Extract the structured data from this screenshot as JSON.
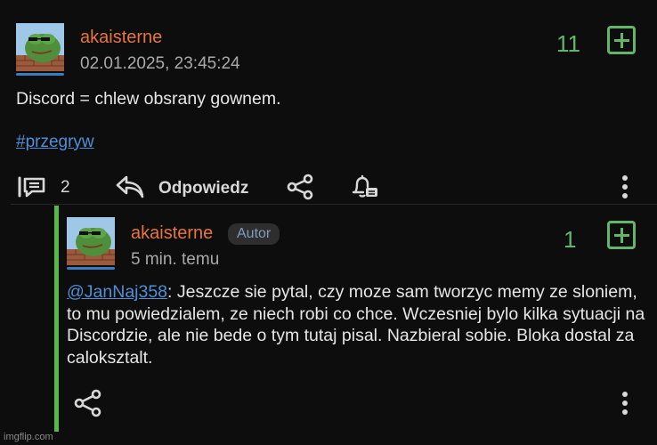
{
  "post": {
    "author": "akaisterne",
    "timestamp": "02.01.2025, 23:45:24",
    "vote_count": "11",
    "content": "Discord = chlew obsrany gownem.",
    "tag": "#przegryw",
    "comment_count": "2",
    "reply_label": "Odpowiedz"
  },
  "reply": {
    "author": "akaisterne",
    "author_badge": "Autor",
    "time_ago": "5 min. temu",
    "vote_count": "1",
    "mention": "@JanNaj358",
    "content": ": Jeszcze sie pytal, czy moze sam tworzyc memy ze sloniem, to mu powiedzialem, ze niech robi co chce. Wczesniej bylo kilka sytuacji na Discordzie, ale nie bede o tym tutaj pisal. Nazbieral sobie. Bloka dostal za caloksztalt."
  },
  "watermark": "imgflip.com",
  "colors": {
    "username": "#e8743b",
    "vote_green": "#63b56a",
    "link_blue": "#4f8fd8",
    "reply_bar": "#57b84a",
    "background": "#0d0d0d"
  },
  "icons": [
    "comments-icon",
    "reply-arrow-icon",
    "share-icon",
    "bell-icon",
    "more-vertical-icon",
    "plus-square-icon"
  ]
}
